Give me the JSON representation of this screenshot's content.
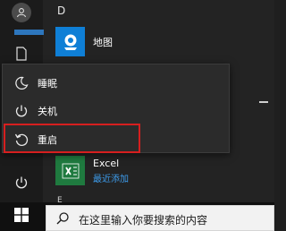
{
  "start_menu": {
    "app_list": {
      "group_d": "D",
      "maps": {
        "label": "地图"
      },
      "excel": {
        "name": "Excel",
        "status": "最近添加"
      },
      "group_e": "E"
    },
    "power_menu": {
      "items": [
        {
          "label": "睡眠",
          "icon": "moon-icon"
        },
        {
          "label": "关机",
          "icon": "power-icon"
        },
        {
          "label": "重启",
          "icon": "restart-icon"
        }
      ],
      "highlight_color": "#d61f1f"
    },
    "left_rail": {
      "icons": [
        "user-avatar-icon",
        "document-icon",
        "power-icon"
      ]
    }
  },
  "taskbar": {
    "start_icon": "windows-logo-icon",
    "search": {
      "placeholder": "在这里输入你要搜索的内容",
      "icon": "search-icon"
    }
  },
  "colors": {
    "accent": "#0f7fd6",
    "excel": "#1f7a3f",
    "link": "#3d9bea"
  }
}
